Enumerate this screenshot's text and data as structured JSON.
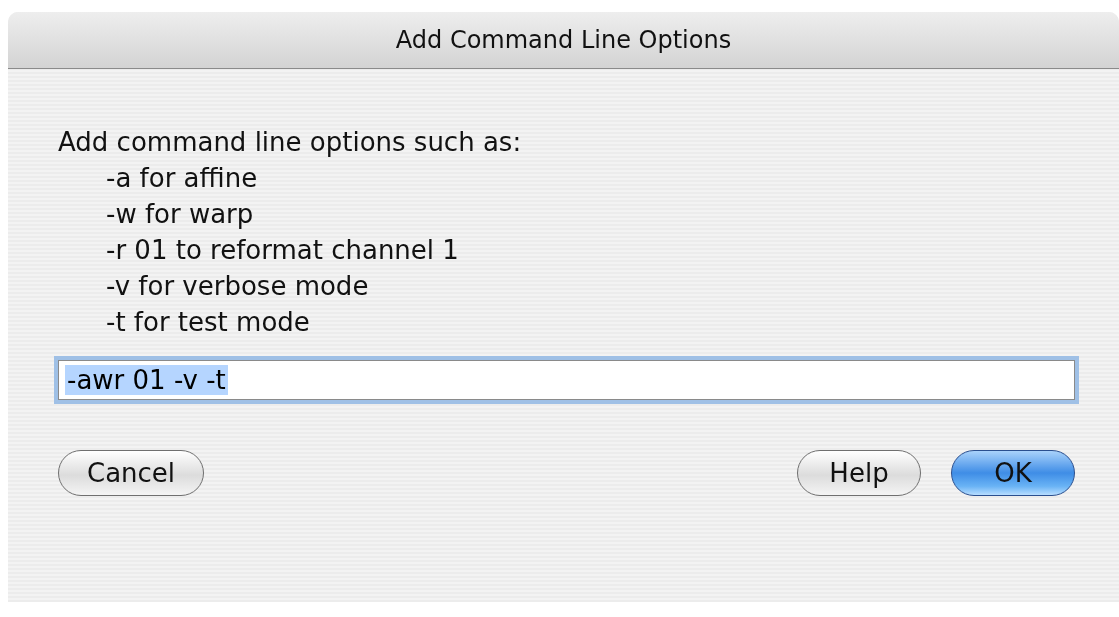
{
  "window": {
    "title": "Add Command Line Options"
  },
  "intro": "Add command line options such as:",
  "options": [
    "-a for affine",
    "-w for warp",
    "-r 01 to reformat channel 1",
    "-v for verbose mode",
    "-t for test mode"
  ],
  "field": {
    "value": "-awr 01 -v -t",
    "text_selected": true,
    "focused": true
  },
  "left_buttons": [
    {
      "label": "Cancel",
      "default": false
    }
  ],
  "right_buttons": [
    {
      "label": "Help",
      "default": false
    },
    {
      "label": "OK",
      "default": true
    }
  ]
}
